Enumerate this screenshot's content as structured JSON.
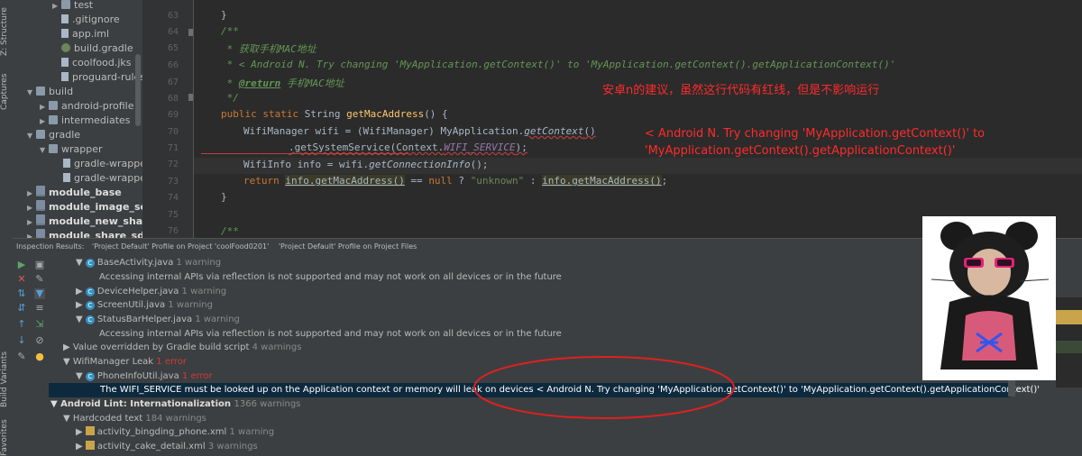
{
  "left_stripe": {
    "tabs": [
      "Z: Structure",
      "Captures",
      "Build Variants",
      "Favorites"
    ]
  },
  "project_tree": {
    "items": [
      {
        "label": "test",
        "icon": "folder-icon"
      },
      {
        "label": ".gitignore",
        "icon": "file-icon"
      },
      {
        "label": "app.iml",
        "icon": "file-icon"
      },
      {
        "label": "build.gradle",
        "icon": "gradle-icon"
      },
      {
        "label": "coolfood.jks",
        "icon": "file-icon"
      },
      {
        "label": "proguard-rules.pro",
        "icon": "file-icon"
      },
      {
        "label": "build",
        "icon": "folder-icon"
      },
      {
        "label": "android-profile",
        "icon": "folder-icon"
      },
      {
        "label": "intermediates",
        "icon": "folder-icon"
      },
      {
        "label": "gradle",
        "icon": "folder-icon"
      },
      {
        "label": "wrapper",
        "icon": "folder-icon"
      },
      {
        "label": "gradle-wrapper.j",
        "icon": "file-icon"
      },
      {
        "label": "gradle-wrapper.p",
        "icon": "file-icon"
      },
      {
        "label": "module_base",
        "icon": "module-folder-icon"
      },
      {
        "label": "module_image_selecte",
        "icon": "module-folder-icon"
      },
      {
        "label": "module_new_share_sc",
        "icon": "module-folder-icon"
      },
      {
        "label": "module_share_sdk",
        "icon": "module-folder-icon"
      }
    ]
  },
  "editor": {
    "line_numbers": [
      "63",
      "64",
      "65",
      "66",
      "67",
      "68",
      "69",
      "70",
      "71",
      "72",
      "73",
      "74",
      "75",
      "76"
    ],
    "code": {
      "l63": "}",
      "l64": "/**",
      "l65_star": " * ",
      "l65_text": "获取手机MAC地址",
      "l66": " * < Android N. Try changing 'MyApplication.getContext()' to 'MyApplication.getContext().getApplicationContext()'",
      "l67_star": " * ",
      "l67_tag": "@return",
      "l67_text": " 手机MAC地址",
      "l68": " */",
      "l69_kw1": "public",
      "l69_kw2": " static",
      "l69_type": " String ",
      "l69_fn": "getMacAddress",
      "l69_rest": "() {",
      "l70_a": "WifiManager wifi = (WifiManager) MyApplication.",
      "l70_b": "getContext",
      "l70_c": "()",
      "l71_a": ".getSystemService(Context.",
      "l71_b": "WIFI_SERVICE",
      "l71_c": ");",
      "l72_a": "WifiInfo info = wifi.",
      "l72_b": "getConnectionInfo",
      "l72_c": "();",
      "l73_kw": "return ",
      "l73_a": "info.getMacAddress()",
      "l73_b": " == ",
      "l73_null": "null",
      "l73_c": " ? ",
      "l73_str": "\"unknown\"",
      "l73_d": " : ",
      "l73_e": "info.getMacAddress()",
      "l73_f": ";",
      "l74": "}",
      "l76": "/**"
    }
  },
  "annotations": {
    "chinese": "安卓n的建议，虽然这行代码有红线，但是不影响运行",
    "english": "< Android N. Try changing 'MyApplication.getContext()' to 'MyApplication.getContext().getApplicationContext()'"
  },
  "inspection": {
    "header": {
      "title": "Inspection Results:",
      "tab1": "'Project Default' Profile on Project 'coolFood0201'",
      "tab2": "'Project Default' Profile on Project Files"
    },
    "rows": {
      "r1_name": "BaseActivity.java",
      "r1_count": "1 warning",
      "r2": "Accessing internal APIs via reflection is not supported and may not work on all devices or in the future",
      "r3_name": "DeviceHelper.java",
      "r3_count": "1 warning",
      "r4_name": "ScreenUtil.java",
      "r4_count": "1 warning",
      "r5_name": "StatusBarHelper.java",
      "r5_count": "1 warning",
      "r6": "Accessing internal APIs via reflection is not supported and may not work on all devices or in the future",
      "r7_name": "Value overridden by Gradle build script",
      "r7_count": "4 warnings",
      "r8_name": "WifiManager Leak",
      "r8_count": "1 error",
      "r9_name": "PhoneInfoUtil.java",
      "r9_count": "1 error",
      "r10": "The WIFI_SERVICE must be looked up on the Application context or memory will leak on devices < Android N. Try changing 'MyApplication.getContext()' to 'MyApplication.getContext().getApplicationContext()'",
      "r11_name": "Android Lint: Internationalization",
      "r11_count": "1366 warnings",
      "r12_name": "Hardcoded text",
      "r12_count": "184 warnings",
      "r13_name": "activity_bingding_phone.xml",
      "r13_count": "1 warning",
      "r14_name": "activity_cake_detail.xml",
      "r14_count": "3 warnings"
    }
  },
  "colors": {
    "annotation_red": "#ff2a2a",
    "error_ellipse": "#e02020",
    "selection": "#0d293e"
  }
}
